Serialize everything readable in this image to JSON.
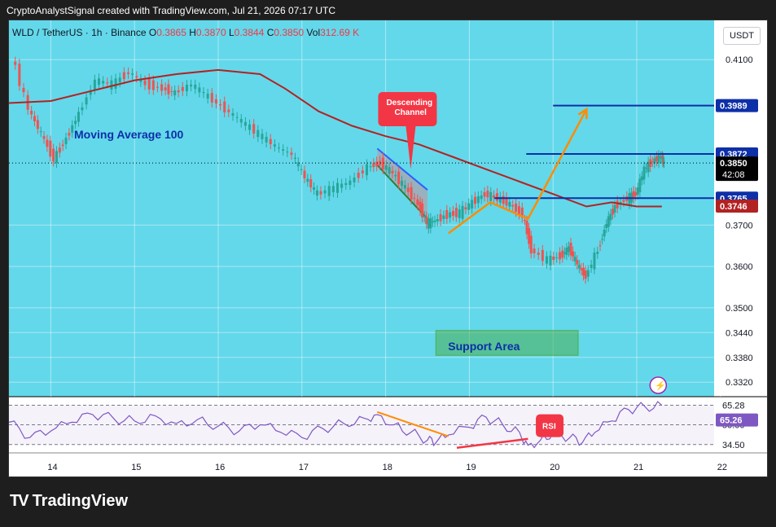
{
  "header": {
    "text": "CryptoAnalystSignal created with TradingView.com, Jul 21, 2026 07:17 UTC"
  },
  "legend": {
    "symbol": "WLD / TetherUS · 1h · Binance",
    "o_label": "O",
    "o": "0.3865",
    "h_label": "H",
    "h": "0.3870",
    "l_label": "L",
    "l": "0.3844",
    "c_label": "C",
    "c": "0.3850",
    "vol_label": "Vol",
    "vol": "312.69 K"
  },
  "currency_button": "USDT",
  "brand": {
    "name": "TradingView",
    "logo": "TV"
  },
  "colors": {
    "bg_price": "#63d8ea",
    "bg_rsi": "#ffffff",
    "up": "#26a69a",
    "down": "#ef5350",
    "ma": "#b22222",
    "blue_line": "#0d2fa8",
    "orange": "#ff8c00",
    "rsi_line": "#7e57c2",
    "support_fill": "#4caf50",
    "callout": "#f23645",
    "dark": "#131722"
  },
  "chart_data": {
    "type": "candlestick",
    "symbol": "WLD / TetherUS",
    "interval": "1h",
    "exchange": "Binance",
    "y_axis": {
      "ticks": [
        0.41,
        0.37,
        0.36,
        0.35,
        0.344,
        0.338,
        0.332
      ],
      "tick_labels": [
        "0.4100",
        "0.3700",
        "0.3600",
        "0.3500",
        "0.3440",
        "0.3380",
        "0.3320"
      ],
      "range": [
        0.3285,
        0.4195
      ]
    },
    "x_axis": {
      "tick_labels": [
        "14",
        "15",
        "16",
        "17",
        "18",
        "19",
        "20",
        "21",
        "22"
      ]
    },
    "price_path": [
      [
        13.55,
        0.411
      ],
      [
        13.75,
        0.398
      ],
      [
        13.9,
        0.392
      ],
      [
        14.05,
        0.386
      ],
      [
        14.2,
        0.391
      ],
      [
        14.35,
        0.397
      ],
      [
        14.55,
        0.405
      ],
      [
        14.75,
        0.404
      ],
      [
        14.95,
        0.407
      ],
      [
        15.15,
        0.404
      ],
      [
        15.35,
        0.403
      ],
      [
        15.5,
        0.402
      ],
      [
        15.7,
        0.404
      ],
      [
        15.9,
        0.401
      ],
      [
        16.1,
        0.398
      ],
      [
        16.3,
        0.395
      ],
      [
        16.5,
        0.392
      ],
      [
        16.7,
        0.389
      ],
      [
        16.9,
        0.387
      ],
      [
        17.05,
        0.3815
      ],
      [
        17.2,
        0.3775
      ],
      [
        17.4,
        0.379
      ],
      [
        17.6,
        0.3805
      ],
      [
        17.8,
        0.384
      ],
      [
        17.95,
        0.385
      ],
      [
        18.1,
        0.3825
      ],
      [
        18.25,
        0.379
      ],
      [
        18.4,
        0.375
      ],
      [
        18.5,
        0.3705
      ],
      [
        18.6,
        0.371
      ],
      [
        18.75,
        0.3725
      ],
      [
        18.9,
        0.373
      ],
      [
        19.05,
        0.3755
      ],
      [
        19.2,
        0.3775
      ],
      [
        19.35,
        0.3765
      ],
      [
        19.5,
        0.375
      ],
      [
        19.65,
        0.3725
      ],
      [
        19.75,
        0.364
      ],
      [
        19.95,
        0.3615
      ],
      [
        20.1,
        0.3625
      ],
      [
        20.2,
        0.3645
      ],
      [
        20.3,
        0.3605
      ],
      [
        20.4,
        0.3575
      ],
      [
        20.55,
        0.364
      ],
      [
        20.65,
        0.3705
      ],
      [
        20.75,
        0.3745
      ],
      [
        20.9,
        0.3765
      ],
      [
        21.0,
        0.3775
      ],
      [
        21.1,
        0.3835
      ],
      [
        21.2,
        0.3855
      ],
      [
        21.3,
        0.3865
      ],
      [
        21.33,
        0.385
      ]
    ],
    "moving_average": {
      "label": "Moving Average 100",
      "path": [
        [
          13.5,
          0.3995
        ],
        [
          14.0,
          0.4
        ],
        [
          14.5,
          0.4025
        ],
        [
          15.0,
          0.405
        ],
        [
          15.5,
          0.4065
        ],
        [
          16.0,
          0.4075
        ],
        [
          16.5,
          0.4065
        ],
        [
          16.8,
          0.403
        ],
        [
          17.2,
          0.3975
        ],
        [
          17.6,
          0.394
        ],
        [
          18.0,
          0.3915
        ],
        [
          18.4,
          0.3895
        ],
        [
          18.8,
          0.3865
        ],
        [
          19.2,
          0.3835
        ],
        [
          19.6,
          0.3805
        ],
        [
          20.0,
          0.3775
        ],
        [
          20.4,
          0.3745
        ],
        [
          20.7,
          0.3755
        ],
        [
          21.0,
          0.3745
        ],
        [
          21.3,
          0.3745
        ]
      ]
    },
    "levels": [
      {
        "label": "0.3989",
        "value": 0.3989,
        "from_x": 20.0,
        "color": "#0d2fa8"
      },
      {
        "label": "0.3872",
        "value": 0.3872,
        "from_x": 19.68,
        "color": "#0d2fa8"
      },
      {
        "label": "0.3765",
        "value": 0.3765,
        "from_x": 19.3,
        "color": "#0d2fa8"
      }
    ],
    "price_labels": [
      {
        "label": "0.3850",
        "sub": "42:08",
        "value": 0.385,
        "style": "current"
      },
      {
        "label": "0.3746",
        "value": 0.3746,
        "style": "ma"
      }
    ],
    "annotations": {
      "descending_channel": {
        "label_line1": "Descending",
        "label_line2": "Channel",
        "upper": [
          [
            17.9,
            0.3885
          ],
          [
            18.5,
            0.3785
          ]
        ],
        "lower": [
          [
            17.9,
            0.3845
          ],
          [
            18.5,
            0.3715
          ]
        ]
      },
      "support_area": {
        "label": "Support Area",
        "x": [
          18.6,
          20.3
        ],
        "y": [
          0.3385,
          0.3445
        ]
      },
      "orange_path": [
        [
          18.75,
          0.368
        ],
        [
          19.25,
          0.3755
        ],
        [
          19.7,
          0.3715
        ],
        [
          20.4,
          0.398
        ]
      ],
      "lightning_icon": "lightning-icon"
    },
    "rsi": {
      "label": "RSI",
      "current_label": "65.26",
      "current": 65.26,
      "levels": [
        {
          "label": "65.28",
          "value": 65.28
        },
        {
          "label": "50.00",
          "value": 50.0
        },
        {
          "label": "34.50",
          "value": 34.5
        }
      ],
      "range": [
        28,
        72
      ],
      "path": [
        [
          13.5,
          52
        ],
        [
          13.75,
          40
        ],
        [
          14.0,
          45
        ],
        [
          14.25,
          52
        ],
        [
          14.5,
          58
        ],
        [
          14.75,
          55
        ],
        [
          15.0,
          53
        ],
        [
          15.25,
          57
        ],
        [
          15.5,
          51
        ],
        [
          15.75,
          54
        ],
        [
          16.0,
          49
        ],
        [
          16.25,
          45
        ],
        [
          16.5,
          50
        ],
        [
          16.75,
          44
        ],
        [
          17.0,
          40
        ],
        [
          17.25,
          47
        ],
        [
          17.5,
          51
        ],
        [
          17.75,
          55
        ],
        [
          17.9,
          58
        ],
        [
          18.1,
          50
        ],
        [
          18.3,
          44
        ],
        [
          18.5,
          38
        ],
        [
          18.6,
          36
        ],
        [
          18.75,
          42
        ],
        [
          19.0,
          48
        ],
        [
          19.2,
          56
        ],
        [
          19.4,
          50
        ],
        [
          19.6,
          44
        ],
        [
          19.7,
          34
        ],
        [
          19.85,
          38
        ],
        [
          20.0,
          44
        ],
        [
          20.2,
          40
        ],
        [
          20.35,
          36
        ],
        [
          20.5,
          44
        ],
        [
          20.7,
          53
        ],
        [
          20.9,
          62
        ],
        [
          21.1,
          64
        ],
        [
          21.3,
          65.26
        ]
      ],
      "divergence_orange": [
        [
          17.9,
          60
        ],
        [
          18.75,
          41
        ]
      ],
      "divergence_red": [
        [
          18.85,
          32
        ],
        [
          19.7,
          39
        ]
      ]
    }
  }
}
